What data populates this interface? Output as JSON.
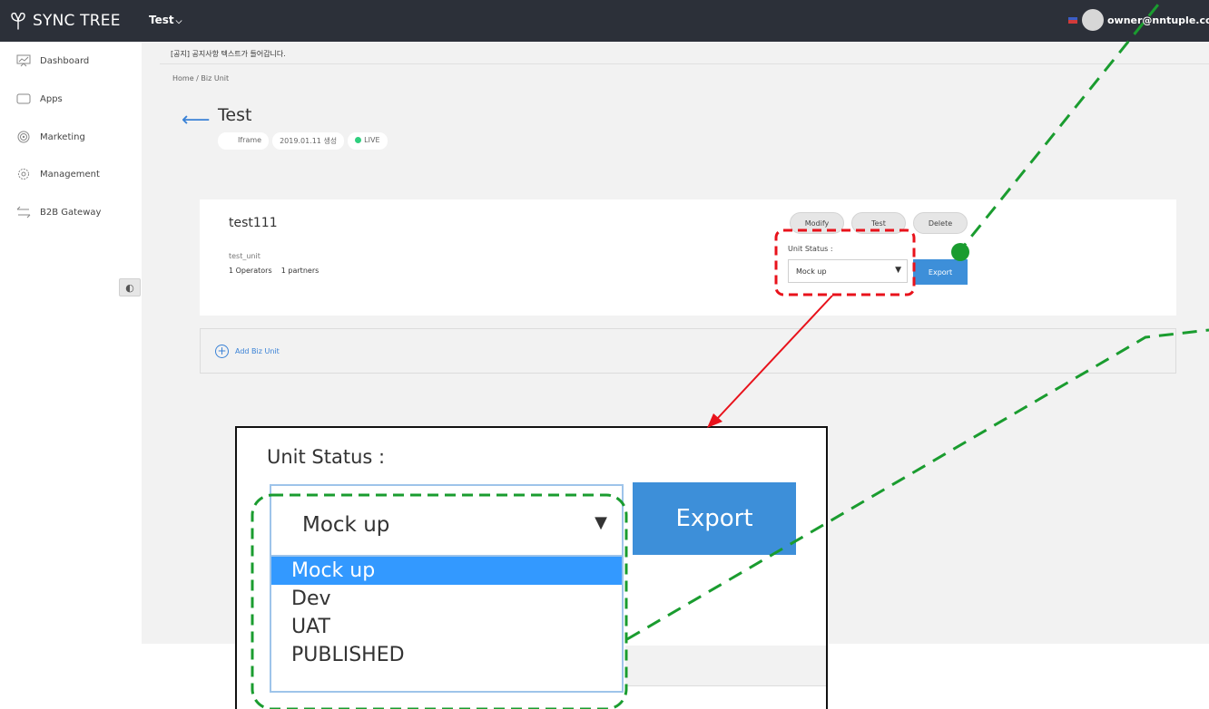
{
  "app": {
    "logo_text": "SYNC TREE",
    "project_name": "Test",
    "user_email": "owner@nntuple.com"
  },
  "sidebar": {
    "items": [
      {
        "label": "Dashboard",
        "icon": "dashboard-icon"
      },
      {
        "label": "Apps",
        "icon": "apps-icon"
      },
      {
        "label": "Marketing",
        "icon": "target-icon"
      },
      {
        "label": "Management",
        "icon": "gear-icon"
      },
      {
        "label": "B2B Gateway",
        "icon": "swap-arrows-icon"
      }
    ],
    "collapse_icon": "collapse-icon"
  },
  "main": {
    "notice": "[공지] 공지사항 텍스트가 들어갑니다.",
    "breadcrumb": "Home  /  Biz Unit",
    "title": "Test",
    "badges": {
      "type": "Iframe",
      "created": "2019.01.11 생성",
      "status": "LIVE"
    }
  },
  "card": {
    "title": "test111",
    "code": "test_unit",
    "operators": "1 Operators",
    "partners": "1 partners",
    "buttons": {
      "modify": "Modify",
      "test": "Test",
      "delete": "Delete"
    },
    "status_label": "Unit Status :",
    "status_value": "Mock up",
    "export_label": "Export"
  },
  "add_unit": {
    "label": "Add Biz Unit"
  },
  "zoom": {
    "status_label": "Unit Status :",
    "selected_value": "Mock up",
    "export_label": "Export",
    "options": [
      "Mock up",
      "Dev",
      "UAT",
      "PUBLISHED"
    ]
  },
  "colors": {
    "topbar": "#2c3039",
    "accent": "#3d8fd9",
    "live": "#2fcf7e",
    "callout_red": "#e8121b",
    "callout_green": "#1a9c2f"
  }
}
